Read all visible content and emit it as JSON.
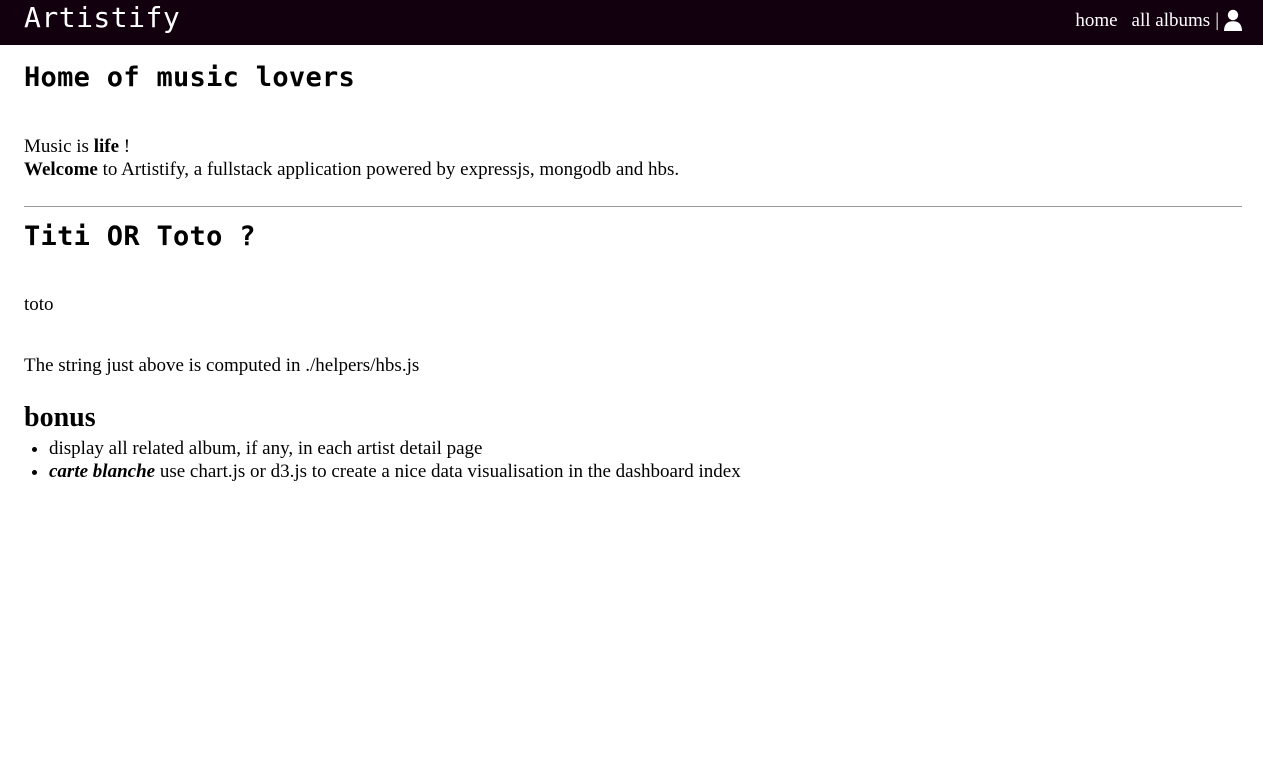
{
  "navbar": {
    "brand": "Artistify",
    "links": {
      "home": "home",
      "all_albums": "all albums",
      "separator": "|"
    },
    "user_icon": "user-icon",
    "background": "#13000f"
  },
  "main": {
    "title": "Home of music lovers",
    "intro": {
      "line1_prefix": "Music is ",
      "line1_bold": "life",
      "line1_suffix": " !",
      "line2_bold": "Welcome",
      "line2_rest": " to Artistify, a fullstack application powered by expressjs, mongodb and hbs."
    },
    "section_title": "Titi OR Toto ?",
    "computed_value": "toto",
    "helper_note": "The string just above is computed in ./helpers/hbs.js",
    "bonus": {
      "title": "bonus",
      "item1": "display all related album, if any, in each artist detail page",
      "item2_bold_italic": "carte blanche",
      "item2_rest": " use chart.js or d3.js to create a nice data visualisation in the dashboard index"
    }
  }
}
